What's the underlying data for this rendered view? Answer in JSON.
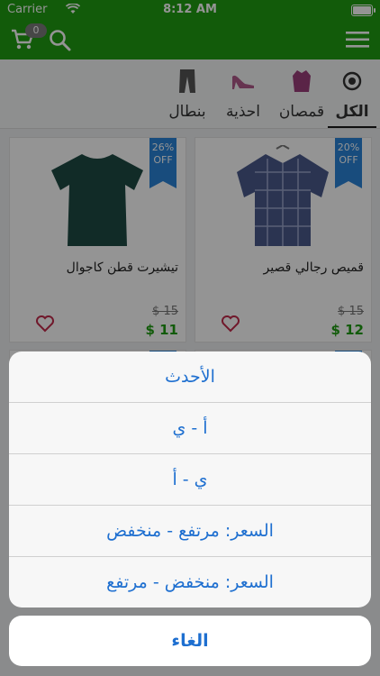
{
  "status": {
    "carrier": "Carrier",
    "time": "8:12 AM"
  },
  "navbar": {
    "cart_count": "0"
  },
  "tabs": [
    {
      "label": "الكل",
      "icon": "all-icon"
    },
    {
      "label": "قمصان",
      "icon": "shirt-icon"
    },
    {
      "label": "احذية",
      "icon": "shoe-icon"
    },
    {
      "label": "بنطال",
      "icon": "pants-icon"
    }
  ],
  "products": [
    {
      "name": "قميص رجالي قصير",
      "discount_pct": "20%",
      "discount_off": "OFF",
      "old_price": "$ 15",
      "new_price": "$ 12"
    },
    {
      "name": "تيشيرت قطن كاجوال",
      "discount_pct": "26%",
      "discount_off": "OFF",
      "old_price": "$ 15",
      "new_price": "$ 11"
    }
  ],
  "sort_sheet": {
    "options": [
      "الأحدث",
      "أ - ي",
      "ي - أ",
      "السعر: مرتفع - منخفض",
      "السعر: منخفض - مرتفع"
    ],
    "cancel": "الغاء"
  },
  "colors": {
    "nav_green": "#1f9d12",
    "price_green": "#1f9d12",
    "ribbon_blue": "#2a83d7",
    "action_blue": "#1e6fd0"
  }
}
